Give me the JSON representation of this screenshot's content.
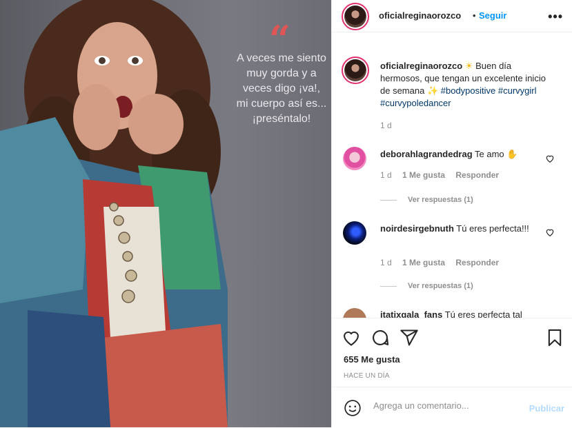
{
  "photo": {
    "quote_mark": "“",
    "quote_lines": [
      "A veces me siento",
      "muy gorda y a",
      "veces digo ¡va!,",
      "mi cuerpo así es...",
      "¡preséntalo!"
    ]
  },
  "header": {
    "username": "oficialreginaorozco",
    "separator": "•",
    "follow_label": "Seguir",
    "more_icon": "more-horizontal-icon"
  },
  "caption": {
    "username": "oficialreginaorozco",
    "emoji_sun": "☀",
    "text": "Buen día hermosos, que tengan un excelente inicio de semana",
    "emoji_sparkle": "✨",
    "hashtags": [
      "#bodypositive",
      "#curvygirl",
      "#curvypoledancer"
    ],
    "time": "1 d"
  },
  "comments": [
    {
      "username": "deborahlagrandedrag",
      "text": "Te amo",
      "emoji": "✋",
      "time": "1 d",
      "likes": "1 Me gusta",
      "reply_label": "Responder",
      "view_replies": "Ver respuestas (1)"
    },
    {
      "username": "noirdesirgebnuth",
      "text": "Tú eres perfecta!!!",
      "time": "1 d",
      "likes": "1 Me gusta",
      "reply_label": "Responder",
      "view_replies": "Ver respuestas (1)"
    },
    {
      "username": "itatixgala_fans",
      "text": "Tú eres perfecta tal"
    }
  ],
  "actions": {
    "icons": [
      "heart-icon",
      "comment-icon",
      "share-icon",
      "bookmark-icon"
    ],
    "likes_text": "655 Me gusta",
    "posted": "HACE UN DÍA"
  },
  "add_comment": {
    "placeholder": "Agrega un comentario...",
    "publish_label": "Publicar"
  },
  "colors": {
    "link": "#0095f6",
    "hashtag": "#00376b",
    "muted": "#8e8e8e",
    "publish_disabled": "#b3dbff",
    "quote_red": "#e05555"
  }
}
